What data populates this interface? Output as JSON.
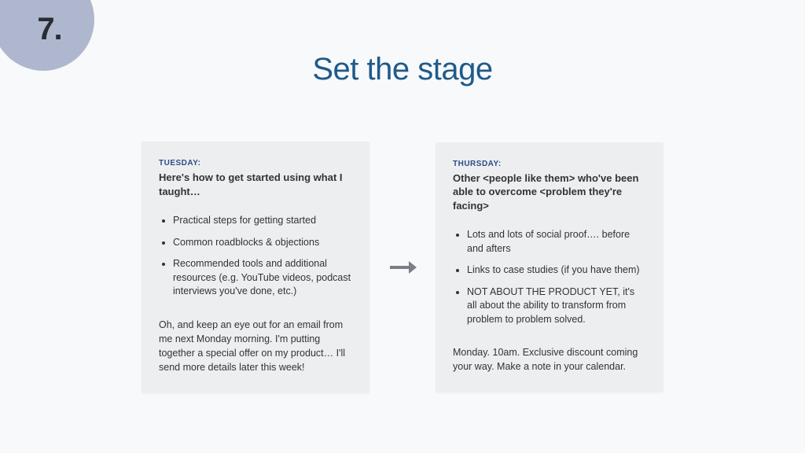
{
  "page_number": "7.",
  "title": "Set the stage",
  "cards": [
    {
      "day": "TUESDAY:",
      "heading": "Here's how to get started using what I taught…",
      "bullets": [
        "Practical steps for getting started",
        "Common roadblocks & objections",
        "Recommended tools and additional resources (e.g. YouTube videos, podcast interviews you've done, etc.)"
      ],
      "footer": "Oh, and keep an eye out for an email from me next Monday morning. I'm putting together a special offer on my product… I'll send more details later this week!"
    },
    {
      "day": "THURSDAY:",
      "heading": "Other <people like them> who've been able to overcome <problem they're facing>",
      "bullets": [
        "Lots and lots of social proof…. before and afters",
        "Links to case studies (if you have them)",
        "NOT ABOUT THE PRODUCT YET, it's all about the ability to transform from problem to problem solved."
      ],
      "footer": "Monday. 10am. Exclusive discount coming your way. Make a note in your calendar."
    }
  ]
}
